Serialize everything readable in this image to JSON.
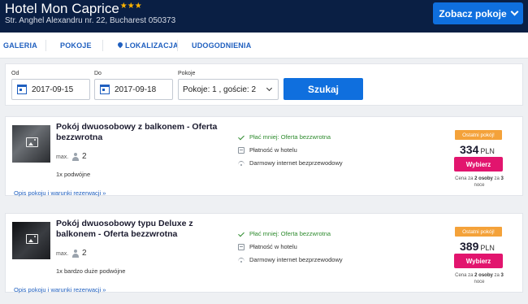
{
  "header": {
    "hotel_name": "Hotel Mon Caprice",
    "stars": "★★★",
    "address": "Str. Anghel Alexandru nr. 22, Bucharest 050373",
    "view_rooms_button": "Zobacz pokoje"
  },
  "nav": {
    "items": [
      "GALERIA",
      "POKOJE",
      "LOKALIZACJA",
      "UDOGODNIENIA"
    ]
  },
  "search": {
    "from_label": "Od",
    "from_value": "2017-09-15",
    "to_label": "Do",
    "to_value": "2017-09-18",
    "rooms_label": "Pokoje",
    "rooms_value": "Pokoje: 1 , goście: 2",
    "search_button": "Szukaj"
  },
  "rooms": [
    {
      "title": "Pokój dwuosobowy z balkonem - Oferta bezzwrotna",
      "max_label": "max.",
      "capacity": "2",
      "bed": "1x podwójne",
      "link": "Opis pokoju i warunki rezerwacji »",
      "amenities": [
        "Płać mniej: Oferta bezzwrotna",
        "Płatność w hotelu",
        "Darmowy internet bezprzewodowy"
      ],
      "badge": "Ostatni pokój!",
      "price": "334",
      "currency": "PLN",
      "select_button": "Wybierz",
      "note_prefix": "Cena za ",
      "note_guests": "2 osoby",
      "note_mid": " za ",
      "note_nights": "3",
      "note_suffix": " noce"
    },
    {
      "title": "Pokój dwuosobowy typu Deluxe z balkonem - Oferta bezzwrotna",
      "max_label": "max.",
      "capacity": "2",
      "bed": "1x bardzo duże podwójne",
      "link": "Opis pokoju i warunki rezerwacji »",
      "amenities": [
        "Płać mniej: Oferta bezzwrotna",
        "Płatność w hotelu",
        "Darmowy internet bezprzewodowy"
      ],
      "badge": "Ostatni pokój!",
      "price": "389",
      "currency": "PLN",
      "select_button": "Wybierz",
      "note_prefix": "Cena za ",
      "note_guests": "2 osoby",
      "note_mid": " za ",
      "note_nights": "3",
      "note_suffix": " noce"
    }
  ],
  "colors": {
    "header_bg": "#0a1f44",
    "accent_blue": "#0f6fde",
    "select_pink": "#e2156e",
    "badge_orange": "#f4a23a",
    "green": "#2e8b2e"
  }
}
